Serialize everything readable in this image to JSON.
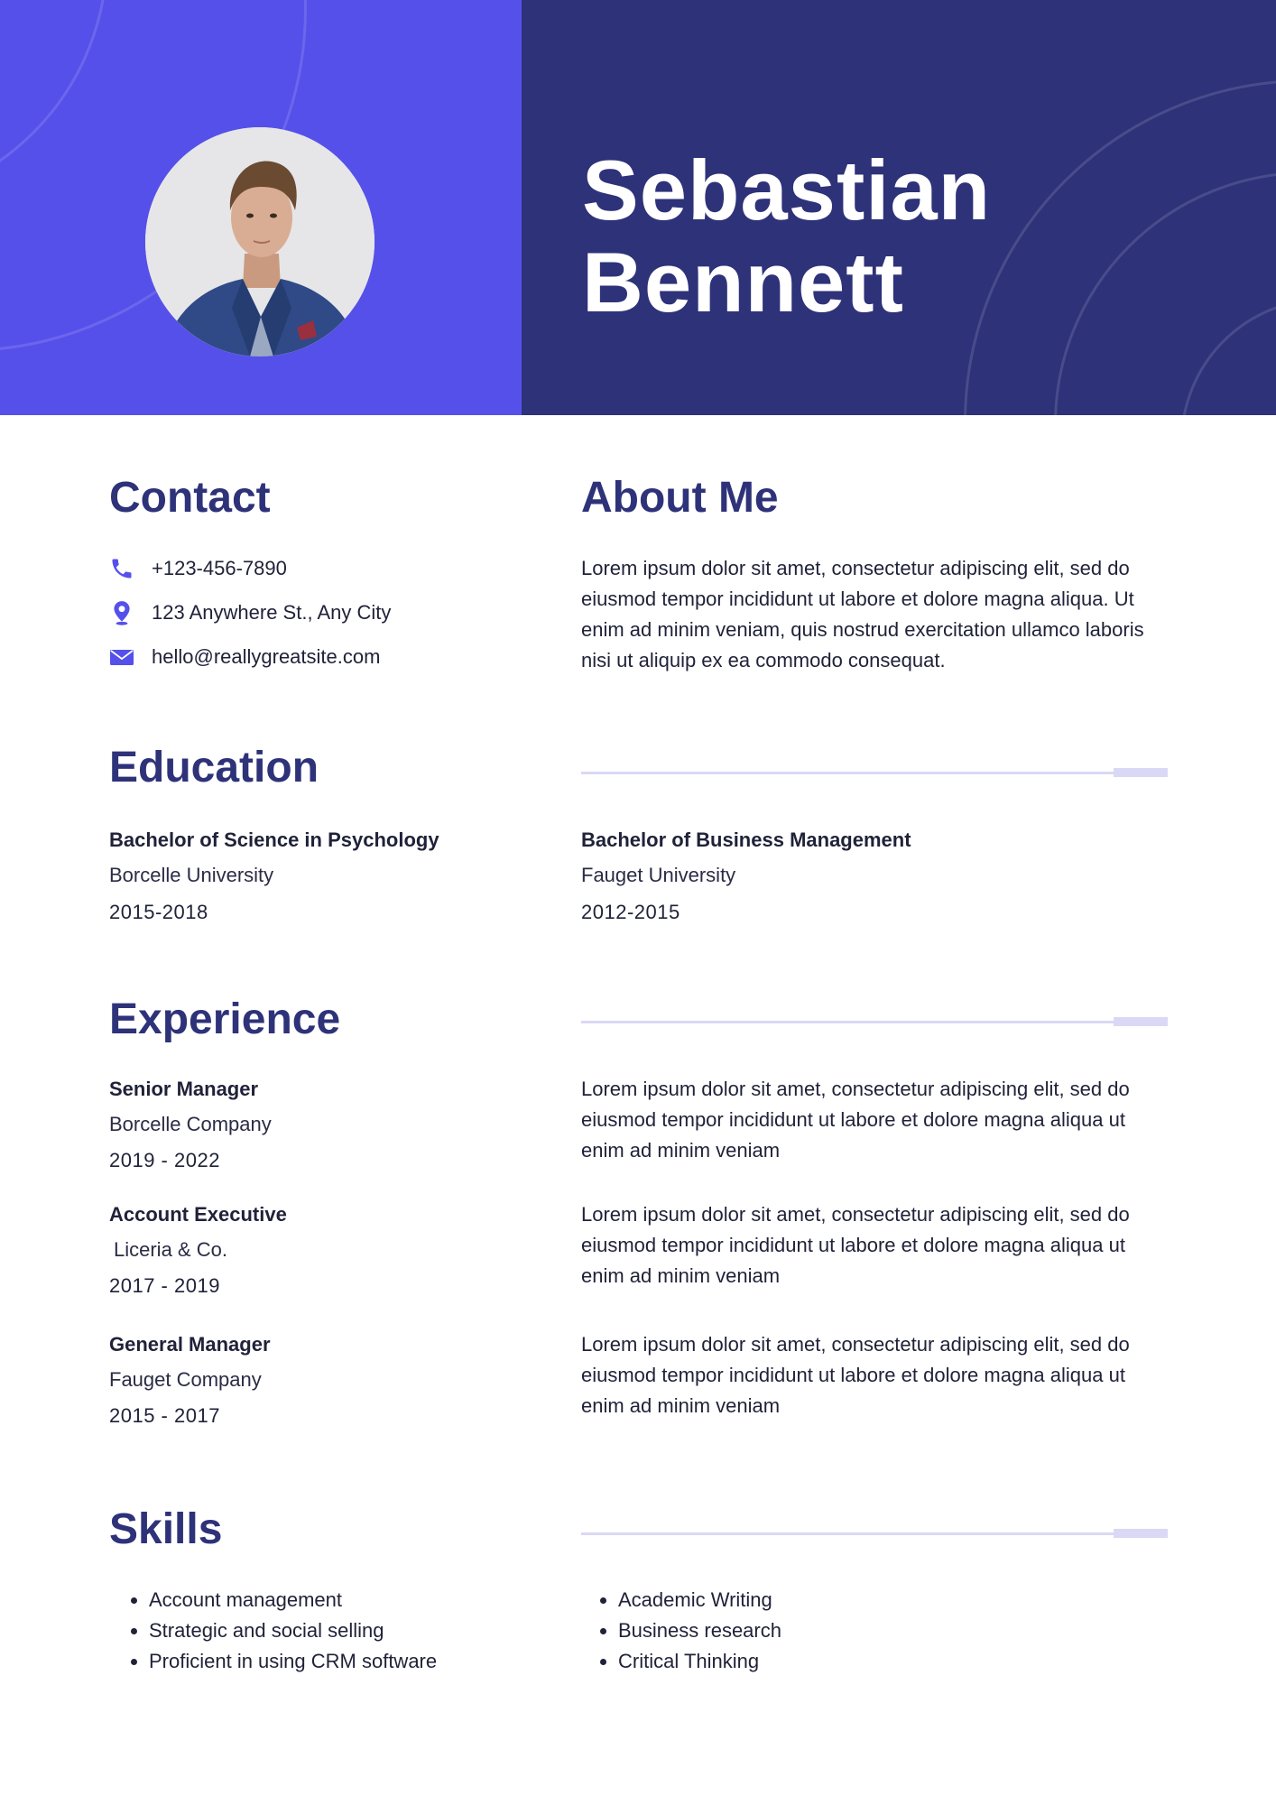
{
  "header": {
    "first_name": "Sebastian",
    "last_name": "Bennett"
  },
  "colors": {
    "accent": "#5650ea",
    "dark_accent": "#2e3279",
    "rule": "#d9d9f5"
  },
  "contact": {
    "title": "Contact",
    "phone": "+123-456-7890",
    "address": "123 Anywhere St., Any City",
    "email": "hello@reallygreatsite.com"
  },
  "about": {
    "title": "About Me",
    "text": "Lorem ipsum dolor sit amet, consectetur adipiscing elit, sed do eiusmod tempor incididunt ut labore et dolore magna aliqua. Ut enim ad minim veniam, quis nostrud exercitation ullamco laboris nisi ut aliquip ex ea commodo consequat."
  },
  "education": {
    "title": "Education",
    "items": [
      {
        "degree": "Bachelor of Science in Psychology",
        "school": "Borcelle University",
        "years": "2015-2018"
      },
      {
        "degree": "Bachelor of Business Management",
        "school": "Fauget University",
        "years": "2012-2015"
      }
    ]
  },
  "experience": {
    "title": "Experience",
    "items": [
      {
        "role": "Senior Manager",
        "company": "Borcelle Company",
        "years": "2019 - 2022",
        "description": "Lorem ipsum dolor sit amet, consectetur adipiscing elit, sed do eiusmod tempor incididunt ut labore et dolore magna aliqua ut enim ad minim veniam"
      },
      {
        "role": "Account Executive",
        "company": "Liceria & Co.",
        "years": "2017 - 2019",
        "description": "Lorem ipsum dolor sit amet, consectetur adipiscing elit, sed do eiusmod tempor incididunt ut labore et dolore magna aliqua ut enim ad minim veniam"
      },
      {
        "role": "General Manager",
        "company": "Fauget Company",
        "years": "2015 - 2017",
        "description": "Lorem ipsum dolor sit amet, consectetur adipiscing elit, sed do eiusmod tempor incididunt ut labore et dolore magna aliqua ut enim ad minim veniam"
      }
    ]
  },
  "skills": {
    "title": "Skills",
    "left": [
      "Account management",
      "Strategic and social selling",
      "Proficient in using CRM software"
    ],
    "right": [
      "Academic Writing",
      "Business research",
      "Critical Thinking"
    ]
  },
  "icons": {
    "phone": "phone-icon",
    "address": "location-pin-icon",
    "email": "envelope-icon"
  }
}
